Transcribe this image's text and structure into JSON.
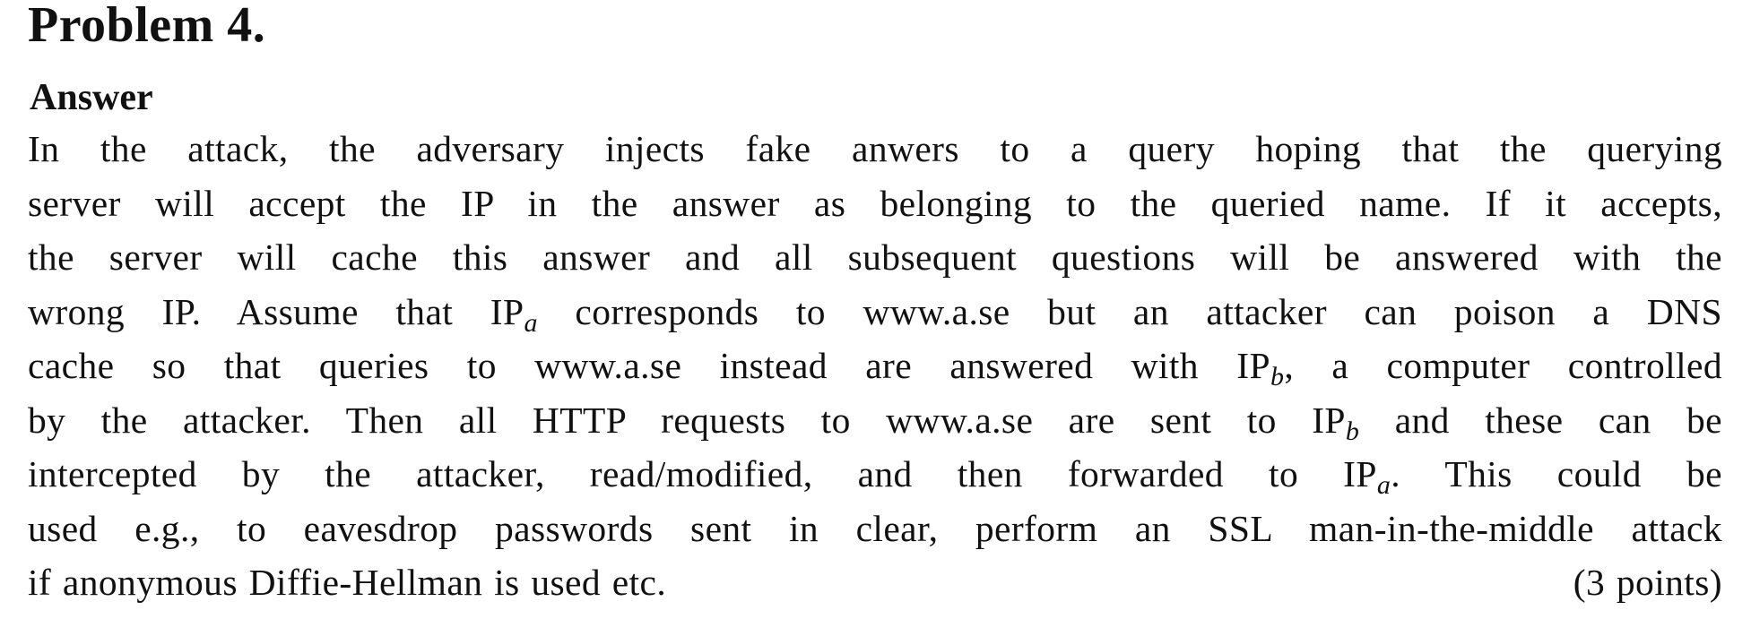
{
  "heading": "Problem 4.",
  "subheading": "Answer",
  "body": {
    "l1": "In the attack, the adversary injects fake anwers to a query hoping that the querying",
    "l2": "server will accept the IP in the answer as belonging to the queried name. If it accepts,",
    "l3": "the server will cache this answer and all subsequent questions will be answered with the",
    "l4a": "wrong IP. Assume that IP",
    "l4sub": "a",
    "l4b": " corresponds to www.a.se but an attacker can poison a DNS",
    "l5a": "cache so that queries to www.a.se instead are answered with IP",
    "l5sub": "b",
    "l5b": ", a computer controlled",
    "l6a": "by the attacker. Then all HTTP requests to www.a.se are sent to IP",
    "l6sub": "b",
    "l6b": " and these can be",
    "l7a": "intercepted by the attacker, read/modified, and then forwarded to IP",
    "l7sub": "a",
    "l7b": ". This could be",
    "l8": "used e.g., to eavesdrop passwords sent in clear, perform an SSL man-in-the-middle attack",
    "l9": "if anonymous Diffie-Hellman is used etc.",
    "points": "(3 points)"
  }
}
